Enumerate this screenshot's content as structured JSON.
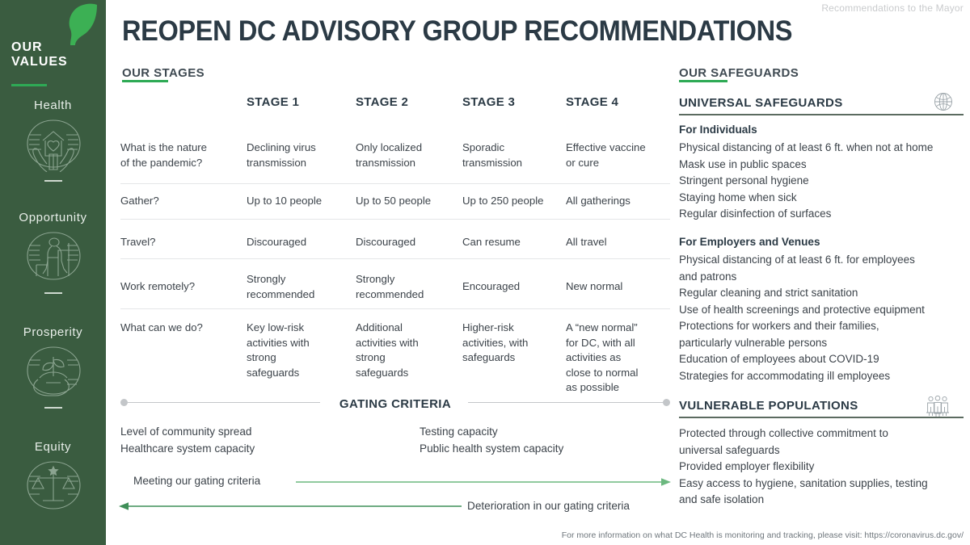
{
  "header": {
    "mayor_note": "Recommendations to the Mayor",
    "title": "REOPEN DC ADVISORY GROUP RECOMMENDATIONS"
  },
  "sidebar": {
    "title_line1": "OUR",
    "title_line2": "VALUES",
    "logo_icon": "leaf-icon",
    "accent_color": "#2eaa55",
    "background_color": "#3a5c40",
    "values": [
      {
        "label": "Health",
        "icon": "hands-holding-home-heart-icon"
      },
      {
        "label": "Opportunity",
        "icon": "person-climbing-stairs-icon"
      },
      {
        "label": "Prosperity",
        "icon": "hand-holding-plant-icon"
      },
      {
        "label": "Equity",
        "icon": "balance-scales-icon"
      }
    ]
  },
  "stages_section": {
    "heading": "OUR STAGES",
    "column_headers": [
      "",
      "STAGE 1",
      "STAGE 2",
      "STAGE 3",
      "STAGE 4"
    ],
    "rows": [
      {
        "question": "What is the nature\nof the pandemic?",
        "stage1": "Declining virus\ntransmission",
        "stage2": "Only localized\ntransmission",
        "stage3": "Sporadic\ntransmission",
        "stage4": "Effective vaccine\nor cure"
      },
      {
        "question": "Gather?",
        "stage1": "Up to 10 people",
        "stage2": "Up to 50 people",
        "stage3": "Up to 250 people",
        "stage4": "All gatherings"
      },
      {
        "question": "Travel?",
        "stage1": "Discouraged",
        "stage2": "Discouraged",
        "stage3": "Can resume",
        "stage4": "All travel"
      },
      {
        "question": "Work remotely?",
        "stage1": "Strongly\nrecommended",
        "stage2": "Strongly\nrecommended",
        "stage3": "Encouraged",
        "stage4": "New normal"
      },
      {
        "question": "What can we do?",
        "stage1": "Key low-risk\nactivities with\nstrong\nsafeguards",
        "stage2": "Additional\nactivities with\nstrong\nsafeguards",
        "stage3": "Higher-risk\nactivities, with\nsafeguards",
        "stage4": "A “new normal”\nfor DC, with all\nactivities as\nclose to normal\nas possible"
      }
    ]
  },
  "gating_section": {
    "title": "GATING CRITERIA",
    "criteria_left": "Level of community spread\nHealthcare system capacity",
    "criteria_right": "Testing capacity\nPublic health system capacity",
    "forward_label": "Meeting our gating criteria",
    "backward_label": "Deterioration in our gating criteria",
    "forward_arrow_color": "#6cb87f",
    "backward_arrow_color": "#3f8f58"
  },
  "safeguards_section": {
    "heading": "OUR SAFEGUARDS",
    "universal": {
      "title": "UNIVERSAL SAFEGUARDS",
      "icon": "globe-icon",
      "individuals_title": "For Individuals",
      "individuals_items": [
        "Physical distancing of at least 6 ft. when not at home",
        "Mask use in public spaces",
        "Stringent personal hygiene",
        "Staying home when sick",
        "Regular disinfection of surfaces"
      ],
      "employers_title": "For Employers and Venues",
      "employers_items": [
        "Physical distancing of at least 6 ft. for employees\nand patrons",
        "Regular cleaning and strict sanitation",
        "Use of health screenings and protective equipment",
        "Protections for workers and their families,\nparticularly vulnerable persons",
        "Education of employees about COVID-19",
        "Strategies for accommodating ill employees"
      ]
    },
    "vulnerable": {
      "title": "VULNERABLE POPULATIONS",
      "icon": "three-people-icon",
      "items": [
        "Protected through collective commitment to\nuniversal safeguards",
        "Provided employer flexibility",
        "Easy access to hygiene, sanitation supplies, testing\nand safe isolation"
      ]
    }
  },
  "footer": {
    "note": "For more information on what DC Health is monitoring and tracking, please visit: https://coronavirus.dc.gov/"
  }
}
